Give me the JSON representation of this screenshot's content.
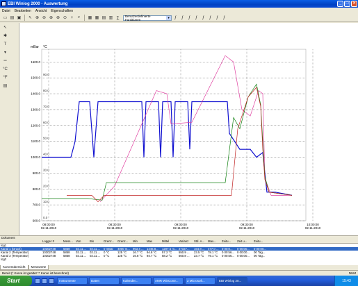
{
  "window": {
    "title": "EBI Winlog 2000 - Auswertung"
  },
  "menu": [
    "Datei",
    "Bearbeiten",
    "Ansicht",
    "Eigenschaften"
  ],
  "toolbar": {
    "function_select": "Benutzerdefinierte Funktionen"
  },
  "chart_data": {
    "type": "line",
    "title": "",
    "left_unit": "mBar",
    "right_unit": "°C",
    "y_left_ticks": [
      600,
      700,
      800,
      900,
      1000,
      1100,
      1200,
      1300,
      1400,
      1500,
      1600
    ],
    "y_right_ticks": [
      "0.0",
      "10.0",
      "20.0",
      "30.0",
      "40.0",
      "50.0",
      "60.0",
      "70.0",
      "80.0",
      "90.0"
    ],
    "x_ticks": [
      {
        "time": "08:00:00",
        "date": "02.11.2010"
      },
      {
        "time": "08:30:00",
        "date": "02.11.2010"
      },
      {
        "time": "09:00:00",
        "date": "02.11.2010"
      },
      {
        "time": "09:30:00",
        "date": "02.11.2010"
      },
      {
        "time": "10:00:00",
        "date": "02.11.2010"
      }
    ],
    "grid": true,
    "series": [
      {
        "color": "#1010d0",
        "values": [
          [
            0,
            1000
          ],
          [
            14,
            1000
          ],
          [
            16,
            1100
          ],
          [
            18,
            1350
          ],
          [
            23,
            1350
          ],
          [
            25,
            1000
          ],
          [
            27,
            1350
          ],
          [
            48,
            1350
          ],
          [
            49,
            1000
          ],
          [
            50,
            1350
          ],
          [
            56,
            1350
          ],
          [
            57,
            1000
          ],
          [
            58,
            1350
          ],
          [
            62,
            1350
          ],
          [
            63,
            1000
          ],
          [
            64,
            1350
          ],
          [
            70,
            1350
          ],
          [
            71,
            1050
          ],
          [
            72,
            1350
          ],
          [
            89,
            1350
          ],
          [
            90,
            1150
          ],
          [
            95,
            1050
          ],
          [
            100,
            1050
          ],
          [
            103,
            1000
          ],
          [
            106,
            1030
          ],
          [
            107,
            900
          ],
          [
            108,
            780
          ],
          [
            112,
            780
          ],
          [
            120,
            760
          ]
        ]
      },
      {
        "color": "#e040a0",
        "values": [
          [
            28,
            720
          ],
          [
            35,
            820
          ],
          [
            55,
            1420
          ],
          [
            60,
            1400
          ],
          [
            62,
            1210
          ],
          [
            72,
            1220
          ],
          [
            88,
            1640
          ],
          [
            92,
            1600
          ],
          [
            96,
            1300
          ],
          [
            100,
            1260
          ],
          [
            104,
            1420
          ],
          [
            106,
            1400
          ],
          [
            107,
            870
          ],
          [
            110,
            760
          ],
          [
            120,
            760
          ]
        ]
      },
      {
        "color": "#108010",
        "values": [
          [
            0,
            740
          ],
          [
            22,
            740
          ],
          [
            29,
            730
          ],
          [
            31,
            840
          ],
          [
            88,
            840
          ],
          [
            92,
            1250
          ],
          [
            95,
            1180
          ],
          [
            99,
            1380
          ],
          [
            103,
            1460
          ],
          [
            105,
            1330
          ],
          [
            106,
            1100
          ],
          [
            107,
            880
          ],
          [
            109,
            780
          ],
          [
            120,
            760
          ]
        ]
      },
      {
        "color": "#c02020",
        "values": [
          [
            12,
            760
          ],
          [
            24,
            760
          ],
          [
            27,
            720
          ],
          [
            30,
            760
          ],
          [
            91,
            760
          ],
          [
            94,
            1180
          ],
          [
            99,
            1380
          ],
          [
            103,
            1440
          ],
          [
            105,
            1320
          ],
          [
            106,
            1050
          ],
          [
            107,
            860
          ],
          [
            109,
            780
          ],
          [
            120,
            760
          ]
        ]
      }
    ]
  },
  "table": {
    "section_title": "Dokument",
    "headers": [
      "",
      "Logger #",
      "Mess...",
      "Von",
      "Bis",
      "Grenz...",
      "Grenz...",
      "Min",
      "Max",
      "Mittel",
      "Varianz",
      "Std. A...",
      "Max...",
      "Zeitu...",
      "Zeit u...",
      "Zeitu..."
    ],
    "rows": [
      [
        "log1",
        "",
        "",
        "",
        "",
        "",
        "",
        "",
        "",
        "",
        "",
        "",
        "",
        "",
        "",
        ""
      ],
      [
        "Kanal 1 (Druck)",
        "10302748",
        "5858",
        "02.11....",
        "02.11....",
        "0 mBar",
        "4000 m...",
        "963.4 ...",
        "1446.8...",
        "1207.5 m...",
        "27167...",
        "164.8 ...",
        "477.0 ...",
        "0 00:0...",
        "0 00:00...",
        "0 00:00..."
      ],
      [
        "Kanal 2 (Temperatur)",
        "10302748",
        "5858",
        "02.11....",
        "02.11....",
        "0 °C",
        "125 °C",
        "16.7 °C",
        "94.8 °C",
        "57.2 °C",
        "550.9 ...",
        "23.5 °C",
        "78.1 °C",
        "0 00:56...",
        "0 00:00...",
        "00 Tag..."
      ],
      [
        "Kanal 3 (Temperatur)",
        "10302748",
        "5858",
        "02.11....",
        "02.11....",
        "0 °C",
        "125 °C",
        "16.8 °C",
        "94.7 °C",
        "58.2 °C",
        "560.8 ...",
        "23.7 °C",
        "79.1 °C",
        "0 00:56...",
        "0 00:00...",
        "00 Tag..."
      ],
      [
        "log2",
        "",
        "",
        "",
        "",
        "",
        "",
        "",
        "",
        "",
        "",
        "",
        "",
        "",
        "",
        ""
      ]
    ]
  },
  "tabs": [
    "Kurvenübersicht",
    "Messwerte"
  ],
  "status": {
    "left": "Bereit (* Kurve ist gealtet  ** Kurve ist berechnet)",
    "right": "NUM"
  },
  "taskbar": {
    "start": "Start",
    "items": [
      "Instrumente",
      "Daten",
      "Kalender...",
      "AMR WinContr...",
      "2 Microsoft...",
      "EBI Winlog 20..."
    ],
    "clock": "15:43"
  }
}
